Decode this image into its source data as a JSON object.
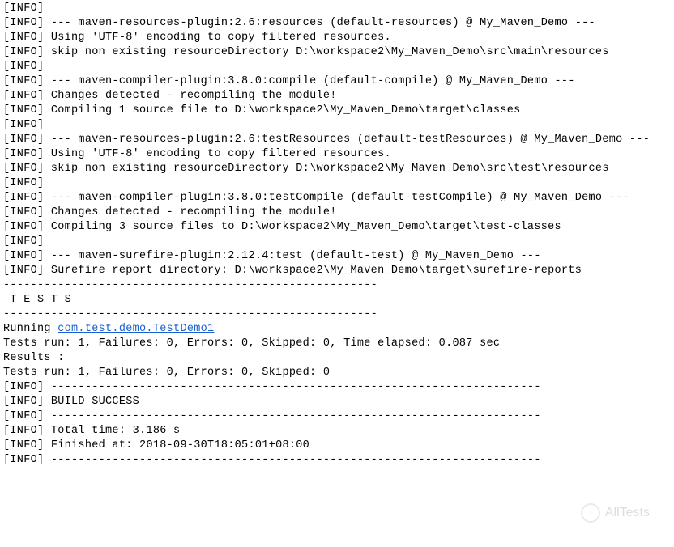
{
  "lines": [
    {
      "prefix": "[INFO]",
      "text": " "
    },
    {
      "prefix": "[INFO]",
      "text": " --- maven-resources-plugin:2.6:resources (default-resources) @ My_Maven_Demo ---"
    },
    {
      "prefix": "[INFO]",
      "text": " Using 'UTF-8' encoding to copy filtered resources."
    },
    {
      "prefix": "[INFO]",
      "text": " skip non existing resourceDirectory D:\\workspace2\\My_Maven_Demo\\src\\main\\resources"
    },
    {
      "prefix": "[INFO]",
      "text": " "
    },
    {
      "prefix": "[INFO]",
      "text": " --- maven-compiler-plugin:3.8.0:compile (default-compile) @ My_Maven_Demo ---"
    },
    {
      "prefix": "[INFO]",
      "text": " Changes detected - recompiling the module!"
    },
    {
      "prefix": "[INFO]",
      "text": " Compiling 1 source file to D:\\workspace2\\My_Maven_Demo\\target\\classes"
    },
    {
      "prefix": "[INFO]",
      "text": " "
    },
    {
      "prefix": "[INFO]",
      "text": " --- maven-resources-plugin:2.6:testResources (default-testResources) @ My_Maven_Demo ---"
    },
    {
      "prefix": "[INFO]",
      "text": " Using 'UTF-8' encoding to copy filtered resources."
    },
    {
      "prefix": "[INFO]",
      "text": " skip non existing resourceDirectory D:\\workspace2\\My_Maven_Demo\\src\\test\\resources"
    },
    {
      "prefix": "[INFO]",
      "text": " "
    },
    {
      "prefix": "[INFO]",
      "text": " --- maven-compiler-plugin:3.8.0:testCompile (default-testCompile) @ My_Maven_Demo ---"
    },
    {
      "prefix": "[INFO]",
      "text": " Changes detected - recompiling the module!"
    },
    {
      "prefix": "[INFO]",
      "text": " Compiling 3 source files to D:\\workspace2\\My_Maven_Demo\\target\\test-classes"
    },
    {
      "prefix": "[INFO]",
      "text": " "
    },
    {
      "prefix": "[INFO]",
      "text": " --- maven-surefire-plugin:2.12.4:test (default-test) @ My_Maven_Demo ---"
    },
    {
      "prefix": "[INFO]",
      "text": " Surefire report directory: D:\\workspace2\\My_Maven_Demo\\target\\surefire-reports"
    },
    {
      "prefix": "",
      "text": ""
    },
    {
      "prefix": "",
      "text": "-------------------------------------------------------"
    },
    {
      "prefix": "",
      "text": " T E S T S"
    },
    {
      "prefix": "",
      "text": "-------------------------------------------------------"
    },
    {
      "prefix": "",
      "text": "Running ",
      "link": "com.test.demo.TestDemo1"
    },
    {
      "prefix": "",
      "text": "Tests run: 1, Failures: 0, Errors: 0, Skipped: 0, Time elapsed: 0.087 sec"
    },
    {
      "prefix": "",
      "text": ""
    },
    {
      "prefix": "",
      "text": "Results :"
    },
    {
      "prefix": "",
      "text": ""
    },
    {
      "prefix": "",
      "text": "Tests run: 1, Failures: 0, Errors: 0, Skipped: 0"
    },
    {
      "prefix": "",
      "text": ""
    },
    {
      "prefix": "[INFO]",
      "text": " ------------------------------------------------------------------------"
    },
    {
      "prefix": "[INFO]",
      "text": " BUILD SUCCESS"
    },
    {
      "prefix": "[INFO]",
      "text": " ------------------------------------------------------------------------"
    },
    {
      "prefix": "[INFO]",
      "text": " Total time: 3.186 s"
    },
    {
      "prefix": "[INFO]",
      "text": " Finished at: 2018-09-30T18:05:01+08:00"
    },
    {
      "prefix": "[INFO]",
      "text": " ------------------------------------------------------------------------"
    }
  ],
  "watermark": {
    "icon": "◌",
    "text": "AllTests"
  }
}
